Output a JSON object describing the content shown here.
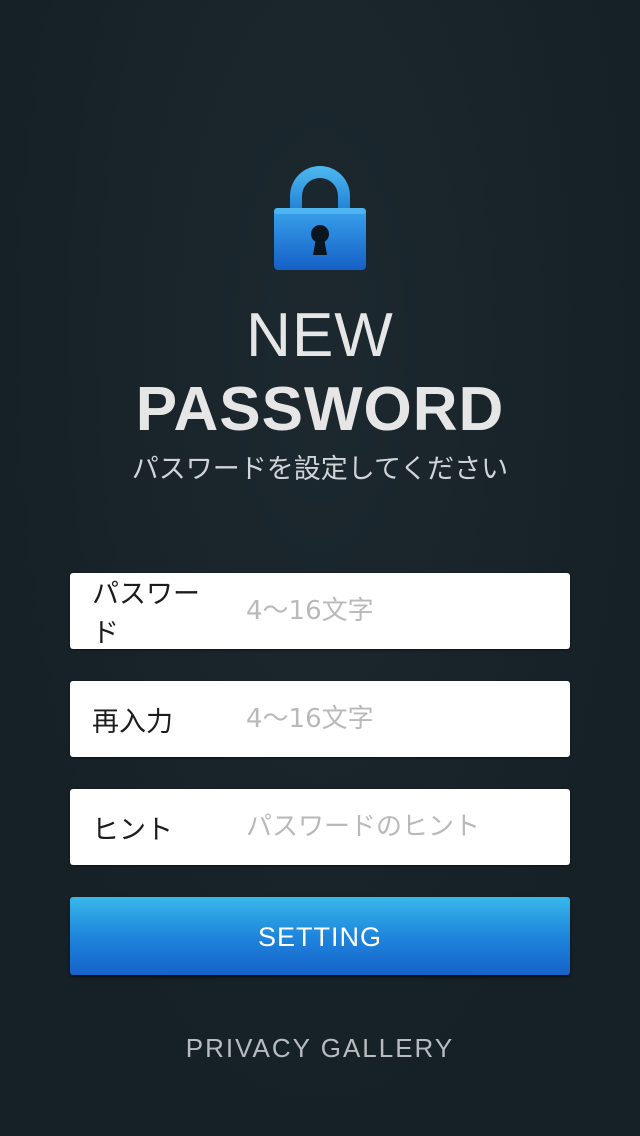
{
  "header": {
    "title_line1": "NEW",
    "title_line2": "PASSWORD",
    "subtitle": "パスワードを設定してください"
  },
  "icons": {
    "lock": "padlock-icon"
  },
  "colors": {
    "background": "#162127",
    "accent_top": "#38b8ea",
    "accent_bottom": "#1662c9",
    "lock_blue": "#1e7fdd"
  },
  "form": {
    "password": {
      "label": "パスワード",
      "placeholder": "4〜16文字",
      "value": ""
    },
    "reenter": {
      "label": "再入力",
      "placeholder": "4〜16文字",
      "value": ""
    },
    "hint": {
      "label": "ヒント",
      "placeholder": "パスワードのヒント",
      "value": ""
    }
  },
  "actions": {
    "setting_label": "SETTING"
  },
  "footer": {
    "brand": "PRIVACY GALLERY"
  }
}
